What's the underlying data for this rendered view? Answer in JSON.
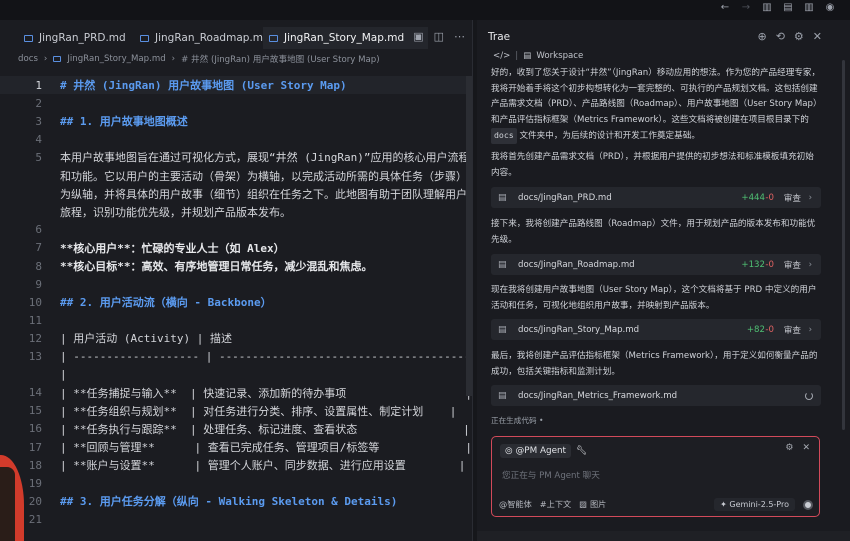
{
  "window": {
    "title_icons": [
      "back-arrow-icon",
      "forward-arrow-icon",
      "layout-left-icon",
      "layout-bottom-icon",
      "layout-right-icon",
      "account-icon"
    ]
  },
  "editor": {
    "tabs": [
      {
        "label": "JingRan_PRD.md",
        "active": false
      },
      {
        "label": "JingRan_Roadmap.md",
        "active": false
      },
      {
        "label": "JingRan_Story_Map.md",
        "active": true
      }
    ],
    "breadcrumb": {
      "folder": "docs",
      "file": "JingRan_Story_Map.md",
      "symbol": "# 井然 (JingRan) 用户故事地图 (User Story Map)"
    },
    "lines": [
      {
        "n": "1",
        "text": "# 井然 (JingRan) 用户故事地图 (User Story Map)",
        "kind": "h"
      },
      {
        "n": "2",
        "text": "",
        "kind": ""
      },
      {
        "n": "3",
        "text": "## 1. 用户故事地图概述",
        "kind": "h"
      },
      {
        "n": "4",
        "text": "",
        "kind": ""
      },
      {
        "n": "5",
        "text": "本用户故事地图旨在通过可视化方式，展现“井然 (JingRan)”应用的核心用户流程",
        "kind": ""
      },
      {
        "n": "",
        "text": "和功能。它以用户的主要活动（骨架）为横轴，以完成活动所需的具体任务（步骤）",
        "kind": ""
      },
      {
        "n": "",
        "text": "为纵轴，并将具体的用户故事（细节）组织在任务之下。此地图有助于团队理解用户",
        "kind": ""
      },
      {
        "n": "",
        "text": "旅程，识别功能优先级，并规划产品版本发布。",
        "kind": ""
      },
      {
        "n": "6",
        "text": "",
        "kind": ""
      },
      {
        "n": "7",
        "text": "**核心用户**：忙碌的专业人士（如 Alex）",
        "kind": "b"
      },
      {
        "n": "8",
        "text": "**核心目标**：高效、有序地管理日常任务，减少混乱和焦虑。",
        "kind": "b"
      },
      {
        "n": "9",
        "text": "",
        "kind": ""
      },
      {
        "n": "10",
        "text": "## 2. 用户活动流（横向 - Backbone）",
        "kind": "h"
      },
      {
        "n": "11",
        "text": "",
        "kind": ""
      },
      {
        "n": "12",
        "text": "| 用户活动 (Activity) | 描述                                          |",
        "kind": ""
      },
      {
        "n": "13",
        "text": "| ------------------- | --------------------------------------------",
        "kind": ""
      },
      {
        "n": "",
        "text": "|",
        "kind": ""
      },
      {
        "n": "14",
        "text": "| **任务捕捉与输入**  | 快速记录、添加新的待办事项                  |",
        "kind": ""
      },
      {
        "n": "15",
        "text": "| **任务组织与规划**  | 对任务进行分类、排序、设置属性、制定计划    |",
        "kind": ""
      },
      {
        "n": "16",
        "text": "| **任务执行与跟踪**  | 处理任务、标记进度、查看状态                |",
        "kind": ""
      },
      {
        "n": "17",
        "text": "| **回顾与管理**      | 查看已完成任务、管理项目/标签等             |",
        "kind": ""
      },
      {
        "n": "18",
        "text": "| **账户与设置**      | 管理个人账户、同步数据、进行应用设置        |",
        "kind": ""
      },
      {
        "n": "19",
        "text": "",
        "kind": ""
      },
      {
        "n": "20",
        "text": "## 3. 用户任务分解（纵向 - Walking Skeleton & Details)",
        "kind": "h"
      },
      {
        "n": "21",
        "text": "",
        "kind": ""
      }
    ]
  },
  "panel": {
    "title": "Trae",
    "workspace": "Workspace",
    "messages": [
      {
        "type": "text",
        "text": "好的，收到了您关于设计“井然”（JingRan）移动应用的想法。作为您的产品经理专家，我将开始着手将这个初步构想转化为一套完整的、可执行的产品规划文档。这包括创建产品需求文档（PRD）、产品路线图（Roadmap）、用户故事地图（User Story Map）和产品评估指标框架（Metrics Framework）。这些文档将被创建在项目根目录下的",
        "code": "docs",
        "after": "文件夹中，为后续的设计和开发工作奠定基础。"
      },
      {
        "type": "text",
        "text": "我将首先创建产品需求文档（PRD），并根据用户提供的初步想法和标准模板填充初始内容。"
      },
      {
        "type": "file",
        "name": "docs/JingRan_PRD.md",
        "added": "+444",
        "removed": "-0",
        "review": "审查"
      },
      {
        "type": "text",
        "text": "接下来，我将创建产品路线图（Roadmap）文件，用于规划产品的版本发布和功能优先级。"
      },
      {
        "type": "file",
        "name": "docs/JingRan_Roadmap.md",
        "added": "+132",
        "removed": "-0",
        "review": "审查"
      },
      {
        "type": "text",
        "text": "现在我将创建用户故事地图（User Story Map），这个文档将基于 PRD 中定义的用户活动和任务，可视化地组织用户故事，并映射到产品版本。"
      },
      {
        "type": "file",
        "name": "docs/JingRan_Story_Map.md",
        "added": "+82",
        "removed": "-0",
        "review": "审查"
      },
      {
        "type": "text",
        "text": "最后，我将创建产品评估指标框架（Metrics Framework），用于定义如何衡量产品的成功，包括关键指标和监测计划。"
      },
      {
        "type": "file",
        "name": "docs/JingRan_Metrics_Framework.md",
        "loading": true
      }
    ],
    "generating": "正在生成代码 •",
    "input": {
      "agent": "@PM Agent",
      "placeholder": "您正在与 PM Agent 聊天",
      "buttons": [
        "@智能体",
        "#上下文",
        "图片"
      ],
      "model": "Gemini-2.5-Pro"
    }
  },
  "colors": {
    "heading": "#5b9bf0",
    "added": "#4fbf73",
    "removed": "#e06262",
    "input_border": "#d24a5a"
  }
}
